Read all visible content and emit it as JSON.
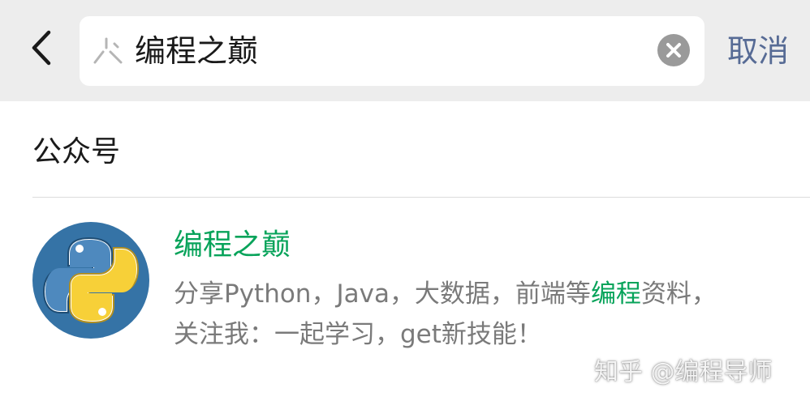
{
  "header": {
    "back_icon": "chevron-left-icon",
    "search": {
      "icon": "mini-program-icon",
      "query": "编程之巅",
      "clear_icon": "clear-icon"
    },
    "cancel_label": "取消"
  },
  "section": {
    "title": "公众号"
  },
  "results": [
    {
      "avatar_icon": "python-logo",
      "name": "编程之巅",
      "desc_line1_a": "分享Python，Java，大数据，前端等",
      "desc_line1_highlight": "编程",
      "desc_line1_b": "资料，",
      "desc_line2": "关注我：一起学习，get新技能！"
    }
  ],
  "watermark": "知乎 @编程导师",
  "colors": {
    "topbar_bg": "#ededed",
    "link_blue": "#576b95",
    "highlight_green": "#07a35a",
    "desc_gray": "#7a7a7a",
    "python_blue": "#3573a6",
    "python_yellow": "#f7d038"
  }
}
